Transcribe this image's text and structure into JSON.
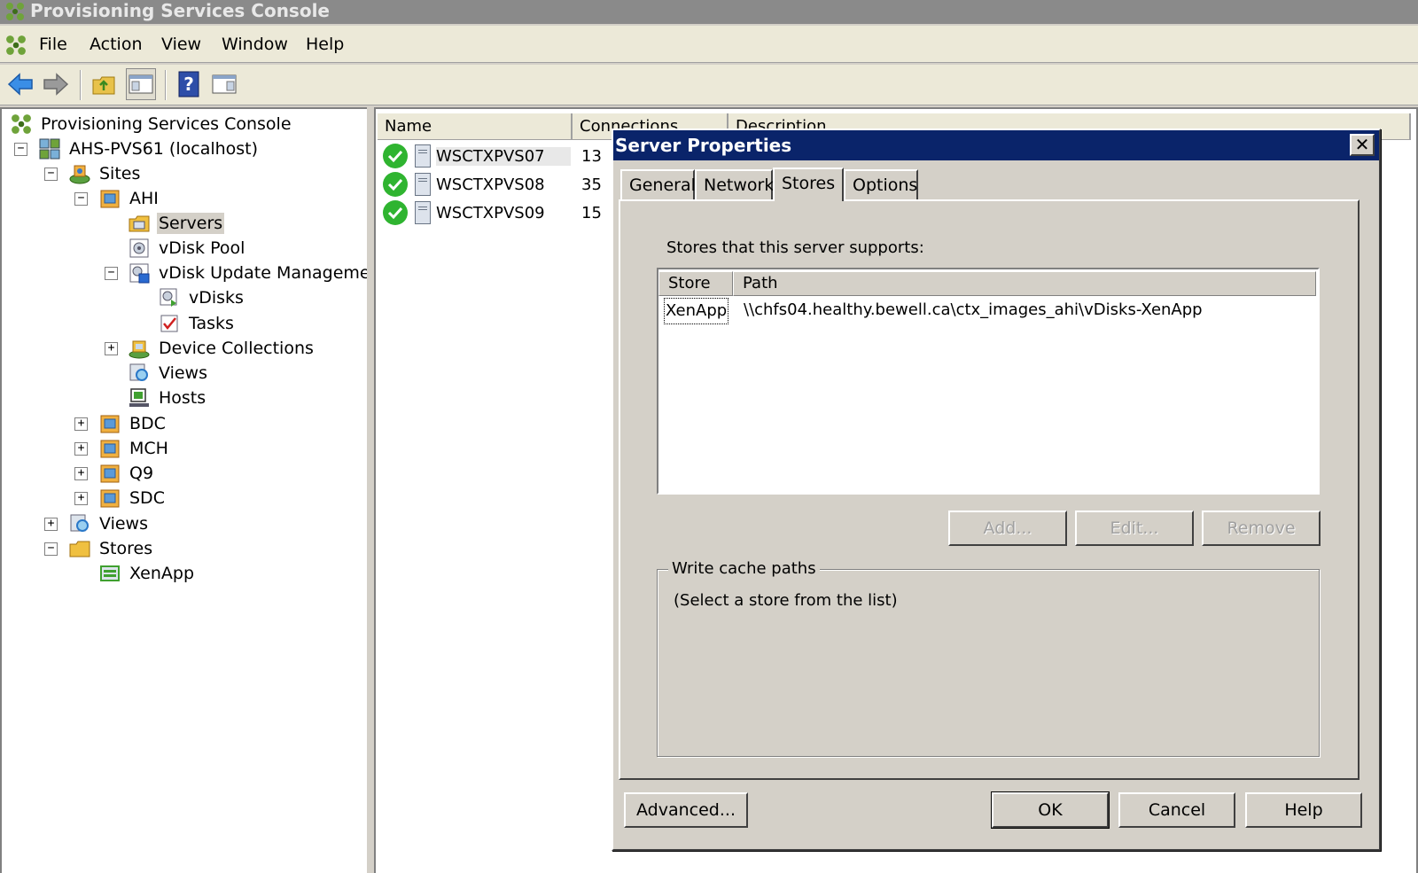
{
  "window": {
    "title": "Provisioning Services Console"
  },
  "menu": {
    "items": [
      "File",
      "Action",
      "View",
      "Window",
      "Help"
    ]
  },
  "tree": {
    "root": "Provisioning Services Console",
    "farm": "AHS-PVS61 (localhost)",
    "sites": "Sites",
    "site_ahi": "AHI",
    "servers": "Servers",
    "vdisk_pool": "vDisk Pool",
    "vdisk_update": "vDisk Update Management",
    "vdisks": "vDisks",
    "tasks": "Tasks",
    "device_collections": "Device Collections",
    "site_views": "Views",
    "hosts": "Hosts",
    "site_bdc": "BDC",
    "site_mch": "MCH",
    "site_q9": "Q9",
    "site_sdc": "SDC",
    "farm_views": "Views",
    "stores": "Stores",
    "store_xenapp": "XenApp"
  },
  "list": {
    "columns": [
      "Name",
      "Connections",
      "Description"
    ],
    "rows": [
      {
        "name": "WSCTXPVS07",
        "connections": "13"
      },
      {
        "name": "WSCTXPVS08",
        "connections": "35"
      },
      {
        "name": "WSCTXPVS09",
        "connections": "15"
      }
    ]
  },
  "dialog": {
    "title": "Server Properties",
    "close": "✕",
    "tabs": [
      "General",
      "Network",
      "Stores",
      "Options"
    ],
    "active_tab": "Stores",
    "stores_label": "Stores that this server supports:",
    "stores_columns": [
      "Store",
      "Path"
    ],
    "stores_rows": [
      {
        "store": "XenApp",
        "path": "\\\\chfs04.healthy.bewell.ca\\ctx_images_ahi\\vDisks-XenApp"
      }
    ],
    "add": "Add...",
    "edit": "Edit...",
    "remove": "Remove",
    "write_cache_title": "Write cache paths",
    "write_cache_hint": "(Select a store from the list)",
    "advanced": "Advanced...",
    "ok": "OK",
    "cancel": "Cancel",
    "help": "Help"
  },
  "colors": {
    "dialog_title_bg": "#0a246a",
    "status_ok": "#2fb430",
    "window_title_bg": "#8a8a8a"
  }
}
